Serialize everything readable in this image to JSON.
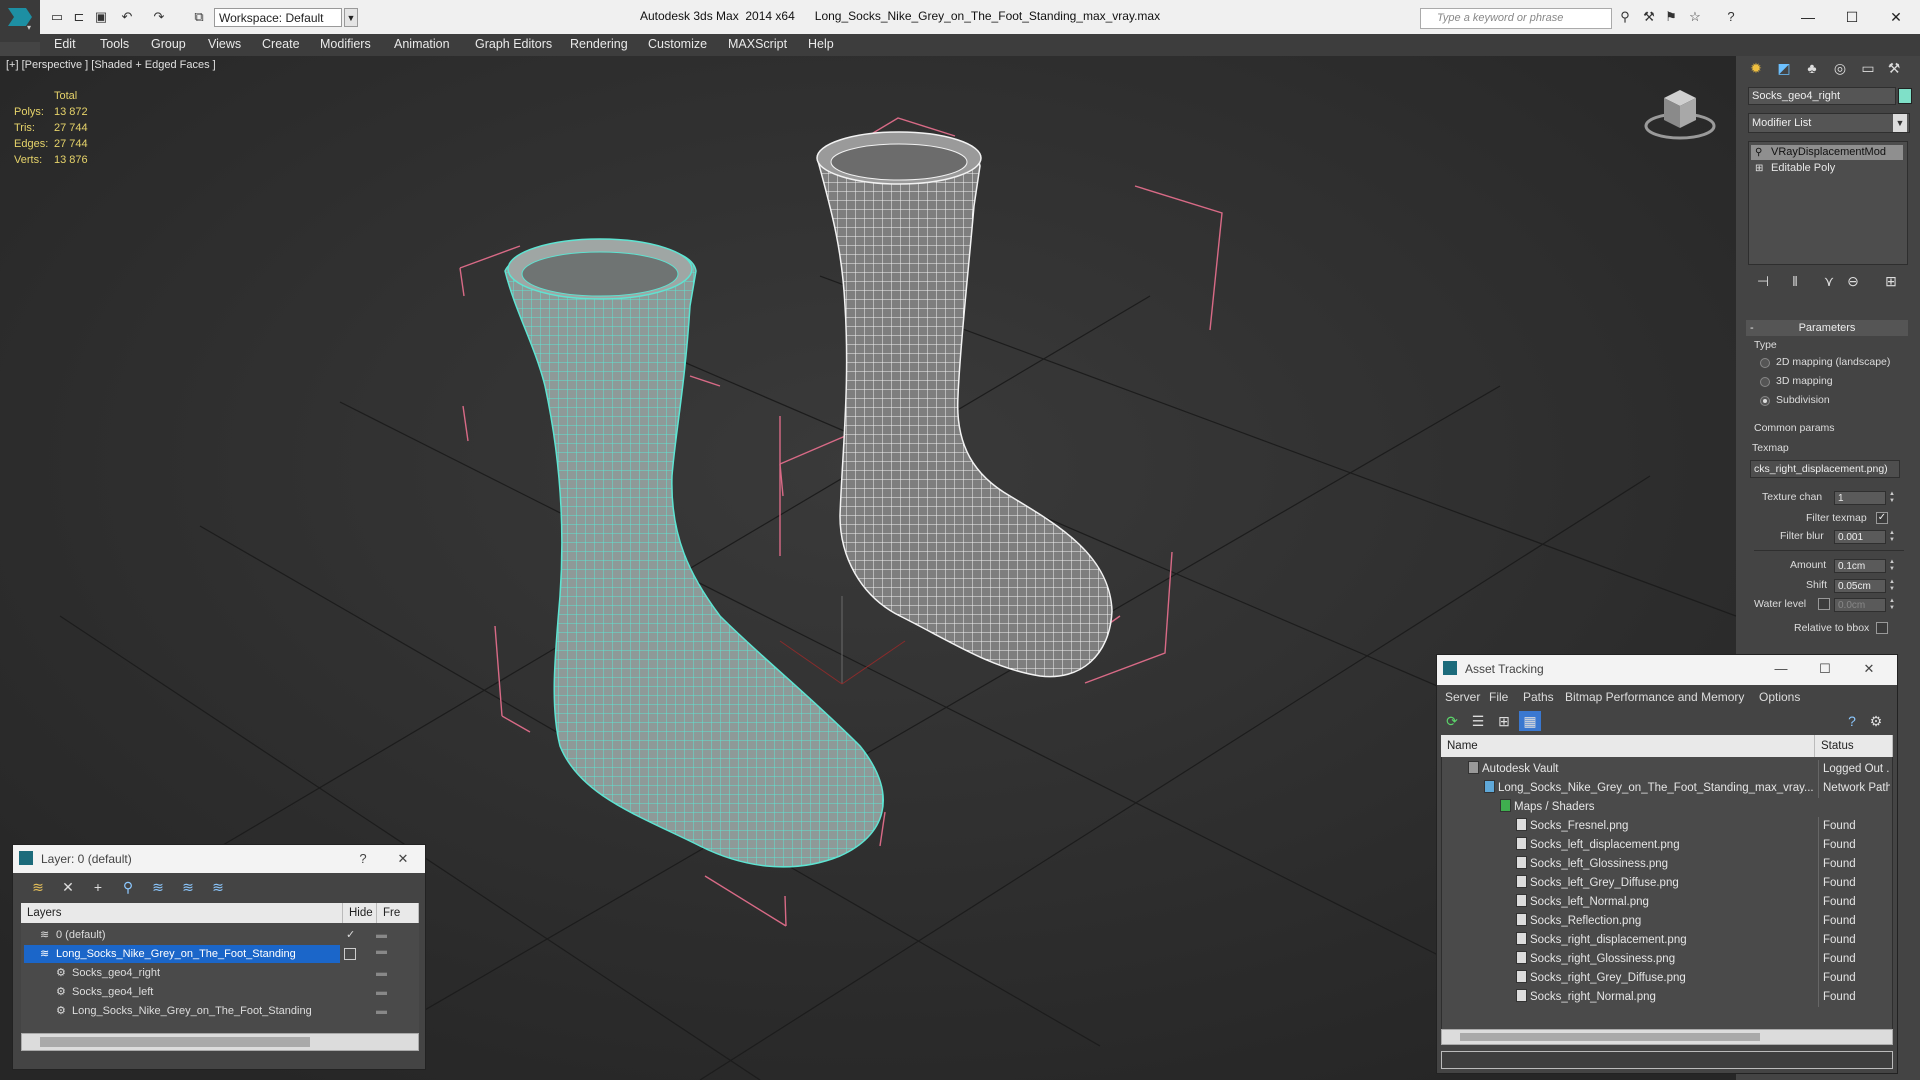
{
  "titlebar": {
    "app_name": "Autodesk 3ds Max  2014 x64",
    "file_name": "Long_Socks_Nike_Grey_on_The_Foot_Standing_max_vray.max",
    "workspace": "Workspace: Default",
    "search_placeholder": "Type a keyword or phrase"
  },
  "menu": [
    "Edit",
    "Tools",
    "Group",
    "Views",
    "Create",
    "Modifiers",
    "Animation",
    "Graph Editors",
    "Rendering",
    "Customize",
    "MAXScript",
    "Help"
  ],
  "viewport": {
    "label": "[+] [Perspective ] [Shaded + Edged Faces ]",
    "stats": {
      "header": "Total",
      "rows": [
        {
          "label": "Polys:",
          "value": "13 872"
        },
        {
          "label": "Tris:",
          "value": "27 744"
        },
        {
          "label": "Edges:",
          "value": "27 744"
        },
        {
          "label": "Verts:",
          "value": "13 876"
        }
      ]
    }
  },
  "command_panel": {
    "object_name": "Socks_geo4_right",
    "object_color": "#7fe0c8",
    "modifier_list_label": "Modifier List",
    "stack": [
      "VRayDisplacementMod",
      "Editable Poly"
    ],
    "rollout_title": "Parameters",
    "type_label": "Type",
    "type_options": [
      {
        "label": "2D mapping (landscape)",
        "selected": false
      },
      {
        "label": "3D mapping",
        "selected": false
      },
      {
        "label": "Subdivision",
        "selected": true
      }
    ],
    "common_params": "Common params",
    "texmap_label": "Texmap",
    "texmap_value": "cks_right_displacement.png)",
    "texture_chan_label": "Texture chan",
    "texture_chan_value": "1",
    "filter_texmap_label": "Filter texmap",
    "filter_texmap_checked": true,
    "filter_blur_label": "Filter blur",
    "filter_blur_value": "0.001",
    "amount_label": "Amount",
    "amount_value": "0.1cm",
    "shift_label": "Shift",
    "shift_value": "0.05cm",
    "water_level_label": "Water level",
    "water_level_value": "0.0cm",
    "relative_bbox_label": "Relative to bbox"
  },
  "layer_dialog": {
    "title": "Layer: 0 (default)",
    "help": "?",
    "columns": [
      "Layers",
      "Hide",
      "Fre"
    ],
    "rows": [
      {
        "name": "0 (default)",
        "indent": 0
      },
      {
        "name": "Long_Socks_Nike_Grey_on_The_Foot_Standing",
        "indent": 0,
        "selected": true
      },
      {
        "name": "Socks_geo4_right",
        "indent": 1
      },
      {
        "name": "Socks_geo4_left",
        "indent": 1
      },
      {
        "name": "Long_Socks_Nike_Grey_on_The_Foot_Standing",
        "indent": 1
      }
    ]
  },
  "asset_tracking": {
    "title": "Asset Tracking",
    "menu": [
      "Server",
      "File",
      "Paths",
      "Bitmap Performance and Memory",
      "Options"
    ],
    "columns": [
      "Name",
      "Status"
    ],
    "rows": [
      {
        "name": "Autodesk Vault",
        "status": "Logged Out ..",
        "indent": 0
      },
      {
        "name": "Long_Socks_Nike_Grey_on_The_Foot_Standing_max_vray....",
        "status": "Network Path",
        "indent": 1
      },
      {
        "name": "Maps / Shaders",
        "status": "",
        "indent": 2
      },
      {
        "name": "Socks_Fresnel.png",
        "status": "Found",
        "indent": 3
      },
      {
        "name": "Socks_left_displacement.png",
        "status": "Found",
        "indent": 3
      },
      {
        "name": "Socks_left_Glossiness.png",
        "status": "Found",
        "indent": 3
      },
      {
        "name": "Socks_left_Grey_Diffuse.png",
        "status": "Found",
        "indent": 3
      },
      {
        "name": "Socks_left_Normal.png",
        "status": "Found",
        "indent": 3
      },
      {
        "name": "Socks_Reflection.png",
        "status": "Found",
        "indent": 3
      },
      {
        "name": "Socks_right_displacement.png",
        "status": "Found",
        "indent": 3
      },
      {
        "name": "Socks_right_Glossiness.png",
        "status": "Found",
        "indent": 3
      },
      {
        "name": "Socks_right_Grey_Diffuse.png",
        "status": "Found",
        "indent": 3
      },
      {
        "name": "Socks_right_Normal.png",
        "status": "Found",
        "indent": 3
      }
    ]
  }
}
